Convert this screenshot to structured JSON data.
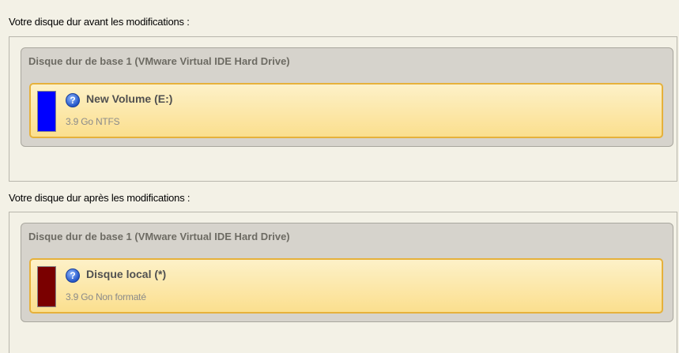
{
  "before": {
    "label": "Votre disque dur avant les modifications :",
    "disk": {
      "title": "Disque dur de base 1 (VMware Virtual IDE Hard Drive)",
      "volume": {
        "name": "New Volume (E:)",
        "info": "3.9 Go NTFS",
        "color": "#0000ff",
        "icon": "question-icon"
      }
    }
  },
  "after": {
    "label": "Votre disque dur après les modifications :",
    "disk": {
      "title": "Disque dur de base 1 (VMware Virtual IDE Hard Drive)",
      "volume": {
        "name": "Disque local (*)",
        "info": "3.9 Go Non formaté",
        "color": "#7a0000",
        "icon": "question-icon"
      }
    }
  }
}
